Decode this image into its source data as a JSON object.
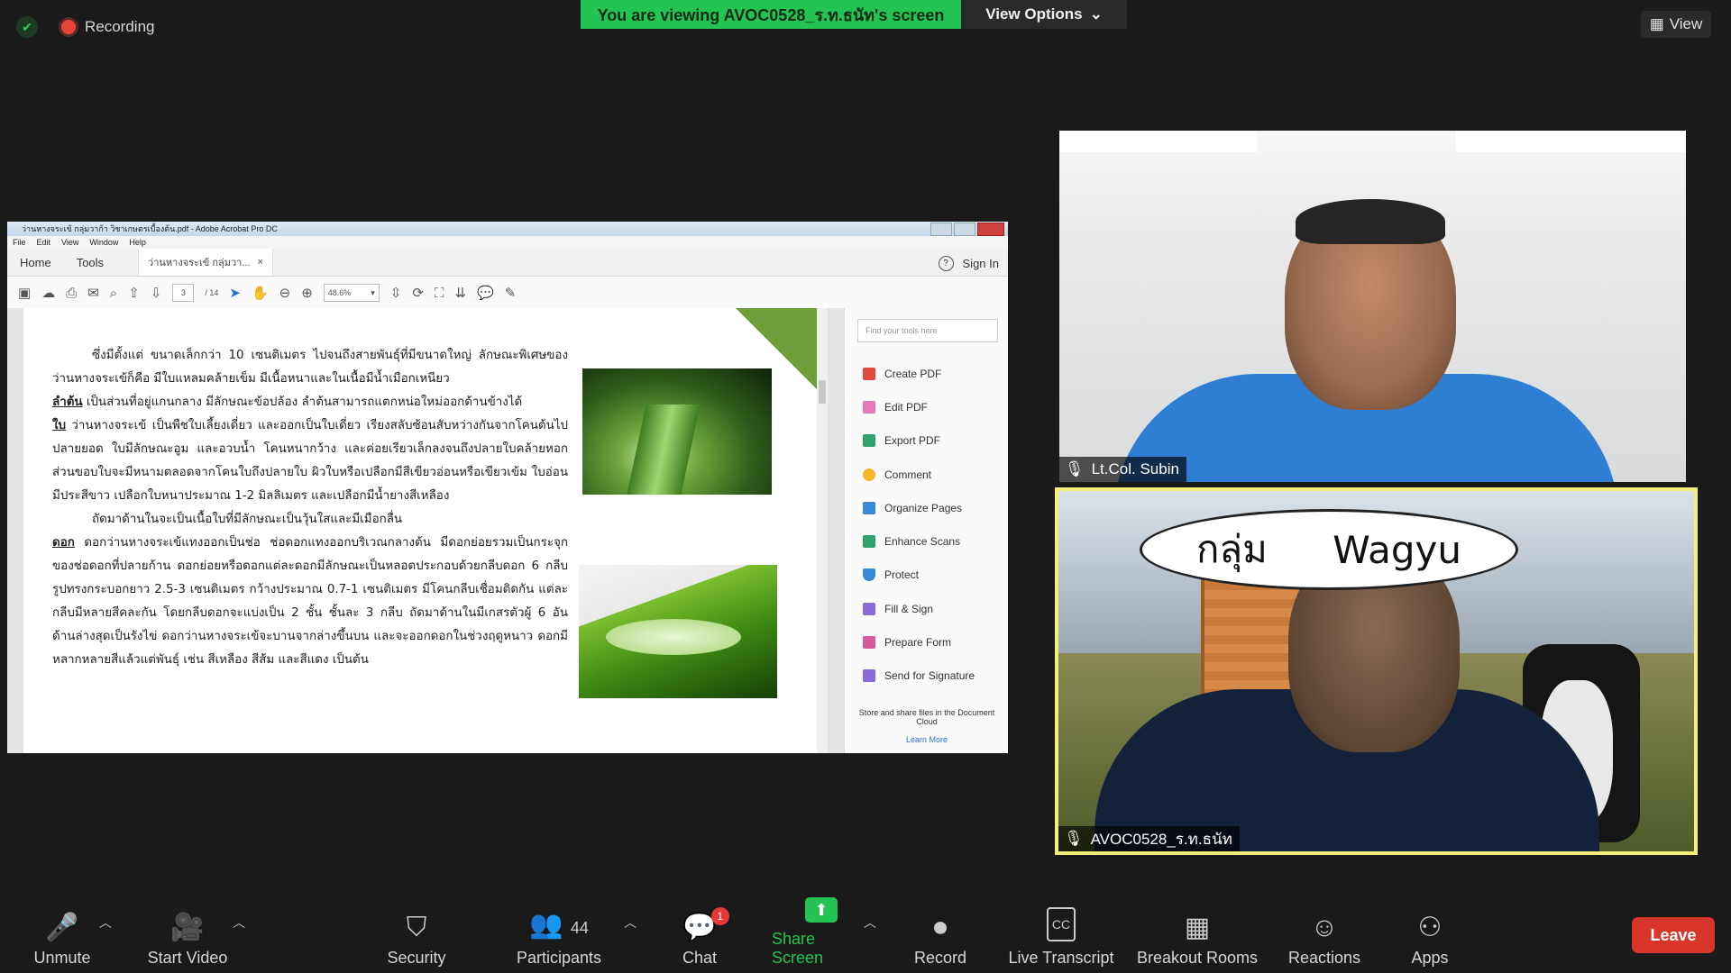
{
  "top": {
    "recording_label": "Recording",
    "viewing_banner": "You are viewing AVOC0528_ร.ท.ธนัท's screen",
    "view_options": "View Options",
    "view_button": "View"
  },
  "acrobat": {
    "window_title": "ว่านหางจระเข้ กลุ่มวาก้า วิชาเกษตรเบื้องต้น.pdf - Adobe Acrobat Pro DC",
    "menu": [
      "File",
      "Edit",
      "View",
      "Window",
      "Help"
    ],
    "tabs": {
      "home": "Home",
      "tools": "Tools",
      "doc": "ว่านหางจระเข้ กลุ่มวา...",
      "close": "×"
    },
    "sign_in": "Sign In",
    "page_current": "3",
    "page_total": "/ 14",
    "zoom": "48.6%",
    "find_placeholder": "Find your tools here",
    "tools": [
      "Create PDF",
      "Edit PDF",
      "Export PDF",
      "Comment",
      "Organize Pages",
      "Enhance Scans",
      "Protect",
      "Fill & Sign",
      "Prepare Form",
      "Send for Signature"
    ],
    "cloud_text": "Store and share files in the Document Cloud",
    "learn_more": "Learn More"
  },
  "document": {
    "p1": "ซึ่งมีตั้งแต่ ขนาดเล็กกว่า 10 เซนติเมตร ไปจนถึงสายพันธุ์ที่มีขนาดใหญ่ ลักษณะพิเศษของว่านหางจระเข้ก็คือ มีใบแหลมคล้ายเข็ม มีเนื้อหนาและในเนื้อมีน้ำเมือกเหนียว",
    "stem_label": "ลำต้น",
    "p2": "เป็นส่วนที่อยู่แกนกลาง มีลักษณะข้อปล้อง ลำต้นสามารถแตกหน่อใหม่ออกด้านข้างได้",
    "leaf_label": "ใบ",
    "p3": "ว่านหางจระเข้ เป็นพืชใบเลี้ยงเดี่ยว และออกเป็นใบเดี่ยว เรียงสลับซ้อนสับหว่างกันจากโคนต้นไปปลายยอด ใบมีลักษณะอูม และอวบน้ำ โคนหนากว้าง และค่อยเรียวเล็กลงจนถึงปลายใบคล้ายหอก ส่วนขอบใบจะมีหนามตลอดจากโคนใบถึงปลายใบ ผิวใบหรือเปลือกมีสีเขียวอ่อนหรือเขียวเข้ม ใบอ่อนมีประสีขาว เปลือกใบหนาประมาณ 1-2 มิลลิเมตร และเปลือกมีน้ำยางสีเหลือง",
    "p4": "ถัดมาด้านในจะเป็นเนื้อใบที่มีลักษณะเป็นวุ้นใสและมีเมือกลื่น",
    "flower_label": "ดอก",
    "p5": "ดอกว่านหางจระเข้แทงออกเป็นช่อ ช่อดอกแทงออกบริเวณกลางต้น มีดอกย่อยรวมเป็นกระจุกของช่อดอกที่ปลายก้าน ดอกย่อยหรือดอกแต่ละดอกมีลักษณะเป็นหลอดประกอบด้วยกลีบดอก 6 กลีบ รูปทรงกระบอกยาว 2.5-3 เซนติเมตร กว้างประมาณ 0.7-1 เซนติเมตร มีโคนกลีบเชื่อมติดกัน แต่ละกลีบมีหลายสีคละกัน โดยกลีบดอกจะแบ่งเป็น 2 ชั้น ชั้นละ 3 กลีบ ถัดมาด้านในมีเกสรตัวผู้ 6 อัน ด้านล่างสุดเป็นรังไข่ ดอกว่านหางจระเข้จะบานจากล่างขึ้นบน และจะออกดอกในช่วงฤดูหนาว ดอกมีหลากหลายสีแล้วแต่พันธุ์ เช่น สีเหลือง สีส้ม และสีแดง เป็นต้น"
  },
  "videos": {
    "participant1": "Lt.Col. Subin",
    "participant2": "AVOC0528_ร.ท.ธนัท",
    "bubble_left": "กลุ่ม",
    "bubble_right": "Wagyu"
  },
  "bottom": {
    "unmute": "Unmute",
    "start_video": "Start Video",
    "security": "Security",
    "participants": "Participants",
    "participants_count": "44",
    "chat": "Chat",
    "chat_badge": "1",
    "share_screen": "Share Screen",
    "record": "Record",
    "live_transcript": "Live Transcript",
    "cc": "CC",
    "breakout_rooms": "Breakout Rooms",
    "reactions": "Reactions",
    "apps": "Apps",
    "leave": "Leave"
  },
  "colors": {
    "share_green": "#23c453",
    "leave_red": "#d9362b",
    "active_speaker": "#f2ef7a"
  }
}
